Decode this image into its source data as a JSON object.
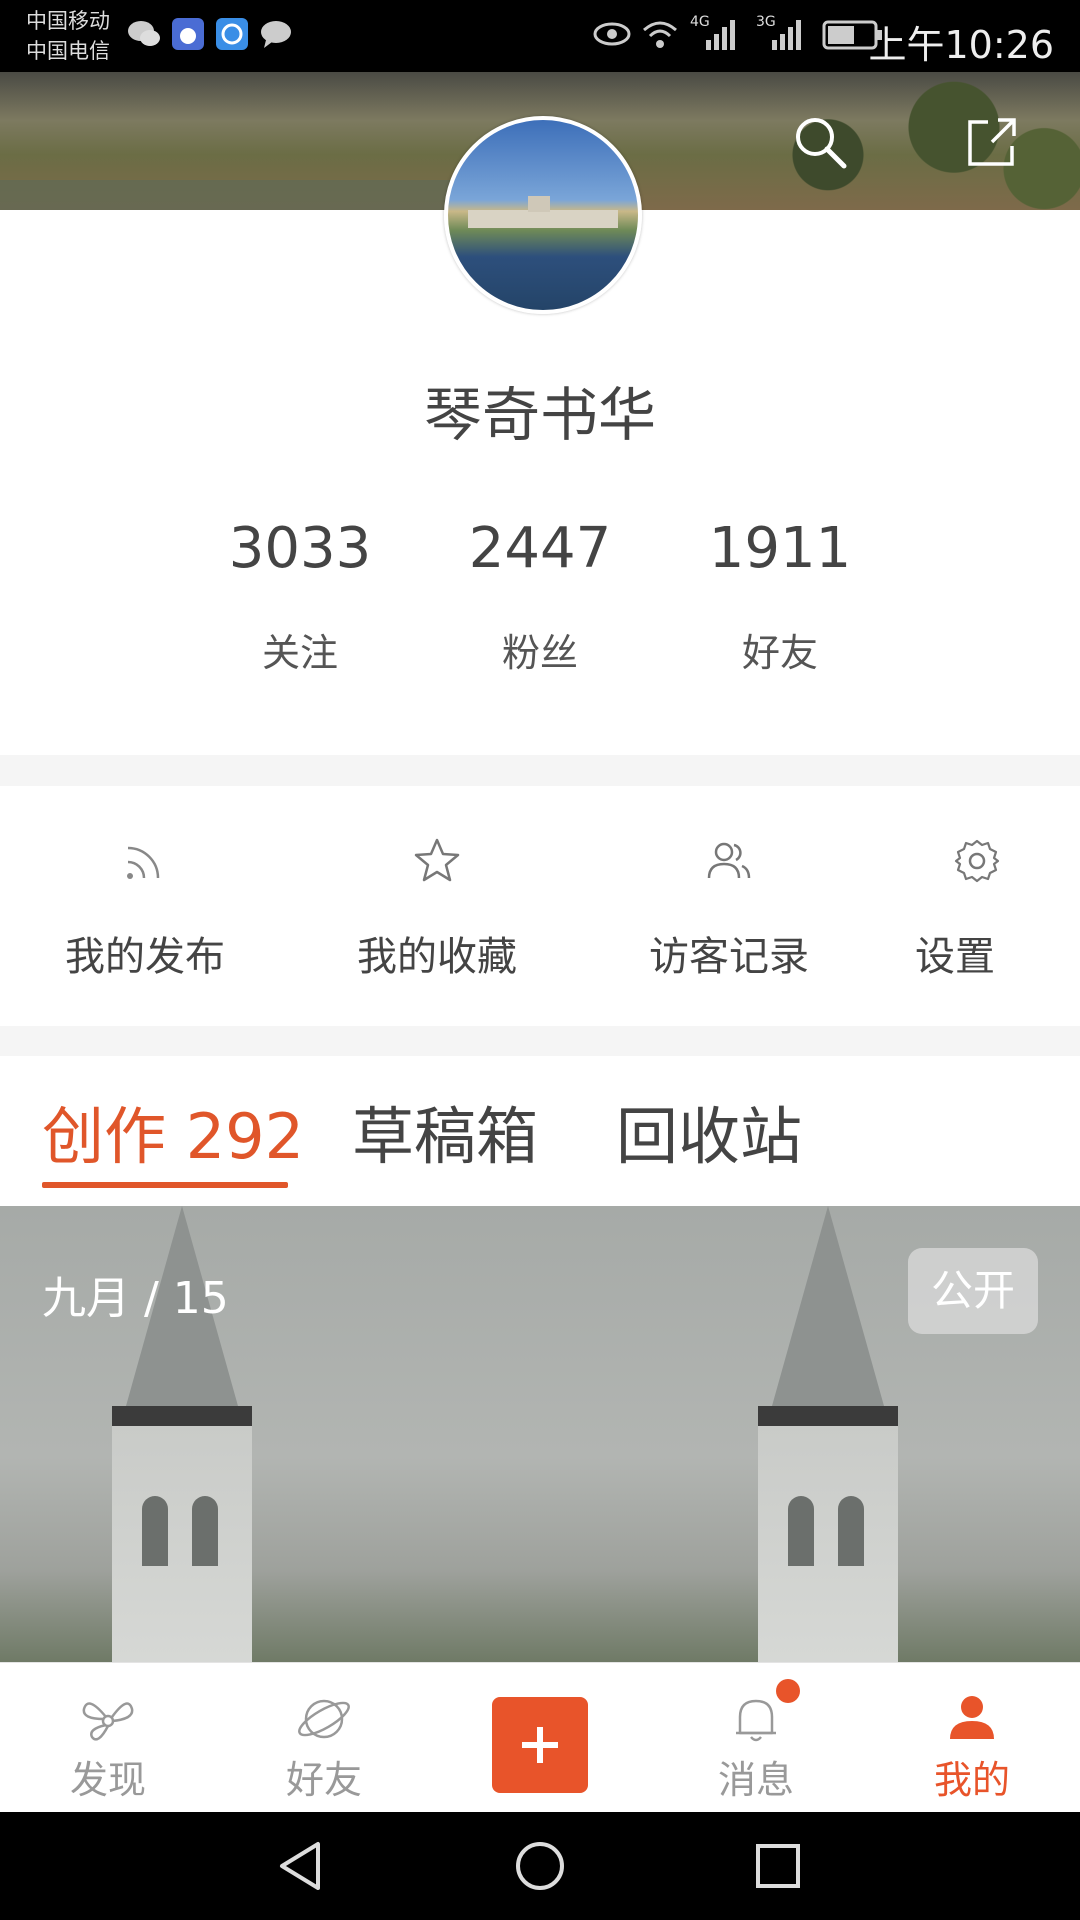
{
  "status_bar": {
    "carrier1": "中国移动",
    "carrier2": "中国电信",
    "network1": "4G",
    "network2": "3G",
    "time": "上午10:26"
  },
  "profile": {
    "username": "琴奇书华",
    "stats": [
      {
        "value": "3033",
        "label": "关注"
      },
      {
        "value": "2447",
        "label": "粉丝"
      },
      {
        "value": "1911",
        "label": "好友"
      }
    ]
  },
  "menu": [
    {
      "label": "我的发布",
      "icon": "rss-icon"
    },
    {
      "label": "我的收藏",
      "icon": "star-icon"
    },
    {
      "label": "访客记录",
      "icon": "users-icon"
    },
    {
      "label": "设置",
      "icon": "gear-icon"
    }
  ],
  "tabs": [
    {
      "label": "创作 292",
      "active": true
    },
    {
      "label": "草稿箱",
      "active": false
    },
    {
      "label": "回收站",
      "active": false
    }
  ],
  "post": {
    "date": "九月 / 15",
    "visibility": "公开"
  },
  "bottom_nav": [
    {
      "label": "发现",
      "icon": "discover-icon",
      "active": false
    },
    {
      "label": "好友",
      "icon": "planet-icon",
      "active": false
    },
    {
      "label": "",
      "icon": "plus-icon",
      "active": false
    },
    {
      "label": "消息",
      "icon": "bell-icon",
      "active": false,
      "badge": true
    },
    {
      "label": "我的",
      "icon": "person-icon",
      "active": true
    }
  ],
  "colors": {
    "accent": "#e8542a",
    "text": "#444444",
    "inactive": "#999999"
  }
}
